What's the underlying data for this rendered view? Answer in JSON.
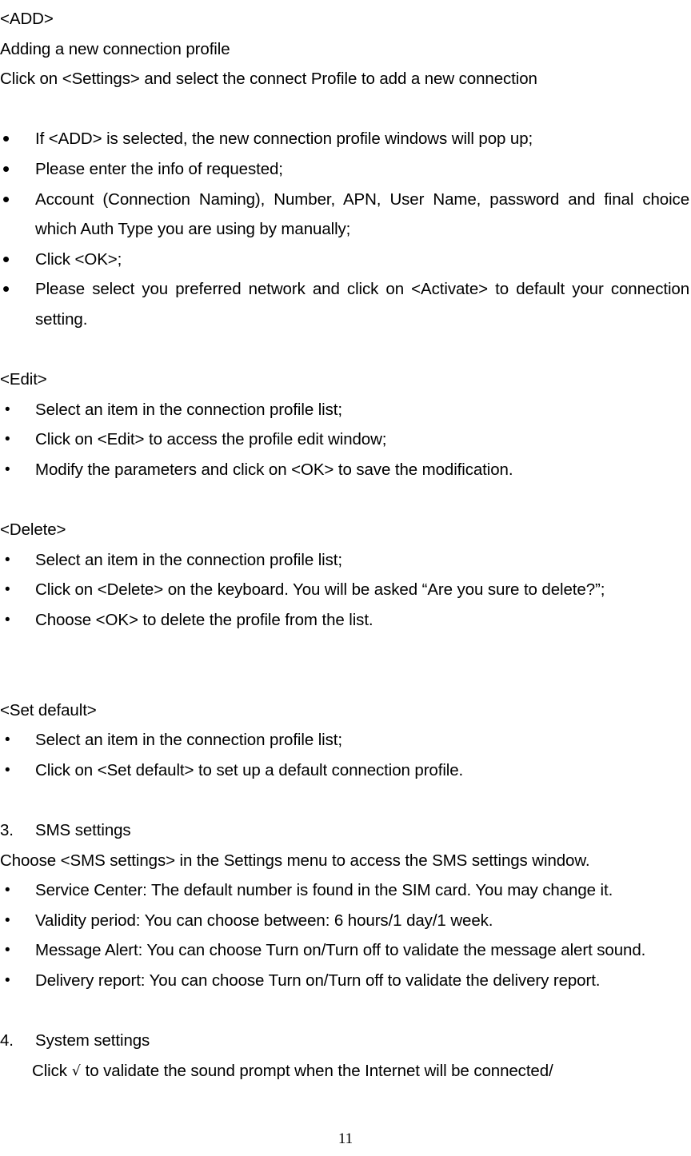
{
  "document": {
    "page_number": "11",
    "sections": [
      {
        "id": "add",
        "heading": "<ADD>",
        "intro_lines": [
          "Adding a new connection profile",
          "Click on <Settings> and select the connect Profile to add a new connection"
        ],
        "bullets": [
          "If <ADD> is selected, the new connection profile windows will pop up;",
          "Please enter the info of requested;",
          "Account (Connection Naming), Number, APN, User Name, password and final choice which Auth Type you are using by manually;",
          "Click <OK>;",
          "Please select you preferred network and click on <Activate> to default your connection setting."
        ]
      },
      {
        "id": "edit",
        "heading": "<Edit>",
        "bullets": [
          "Select an item in the connection profile list;",
          "Click on <Edit> to access the profile edit window;",
          "Modify the parameters and click on <OK> to save the modification."
        ]
      },
      {
        "id": "delete",
        "heading": "<Delete>",
        "bullets": [
          "Select an item in the connection profile list;",
          "Click on <Delete> on the keyboard. You will be asked “Are you sure to delete?”;",
          "Choose <OK> to delete the profile from the list."
        ]
      },
      {
        "id": "set-default",
        "heading": "<Set default>",
        "bullets": [
          "Select an item in the connection profile list;",
          "Click on <Set default> to set up a default connection profile."
        ]
      },
      {
        "id": "sms-settings",
        "number": "3.",
        "heading": "SMS settings",
        "intro_lines": [
          "Choose <SMS settings> in the Settings menu to access the SMS settings window."
        ],
        "bullets": [
          "Service Center: The default number is found in the SIM card. You may change it.",
          "Validity period: You can choose between: 6 hours/1 day/1 week.",
          "Message Alert: You can choose Turn on/Turn off to validate the message alert sound.",
          "Delivery report: You can choose Turn on/Turn off to validate the delivery report."
        ]
      },
      {
        "id": "system-settings",
        "number": "4.",
        "heading": "System settings",
        "body_prefix": "Click",
        "check_icon": "√",
        "body_suffix": "to validate the sound prompt when the Internet will be connected/"
      }
    ]
  }
}
